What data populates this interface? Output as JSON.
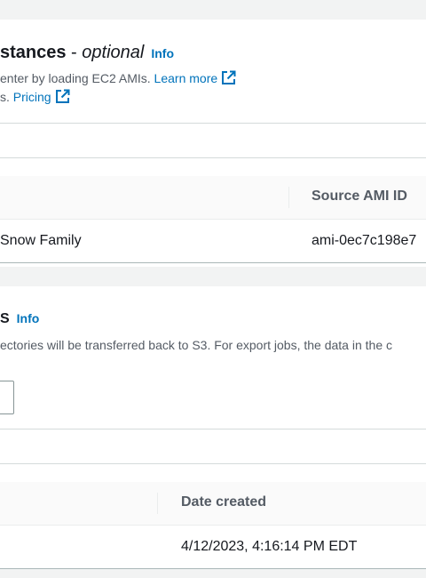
{
  "ec2_section": {
    "title_bold": "stances",
    "title_sep": " - ",
    "title_optional": "optional",
    "info": "Info",
    "desc_line1": "enter by loading EC2 AMIs.",
    "learn_more": "Learn more",
    "desc_line2_prefix": "s.",
    "pricing": "Pricing",
    "table": {
      "col_source_ami": "Source AMI ID",
      "row_name": "Snow Family",
      "row_ami": "ami-0ec7c198e7"
    }
  },
  "s3_section": {
    "title_fragment": "S",
    "info": "Info",
    "desc": "ectories will be transferred back to S3. For export jobs, the data in the c",
    "table": {
      "col_date_created": "Date created",
      "row_date": "4/12/2023, 4:16:14 PM EDT"
    }
  },
  "colors": {
    "link": "#0073bb",
    "background": "#f2f3f3",
    "border": "#d5dbdb"
  },
  "icons": [
    "external-link-icon"
  ]
}
